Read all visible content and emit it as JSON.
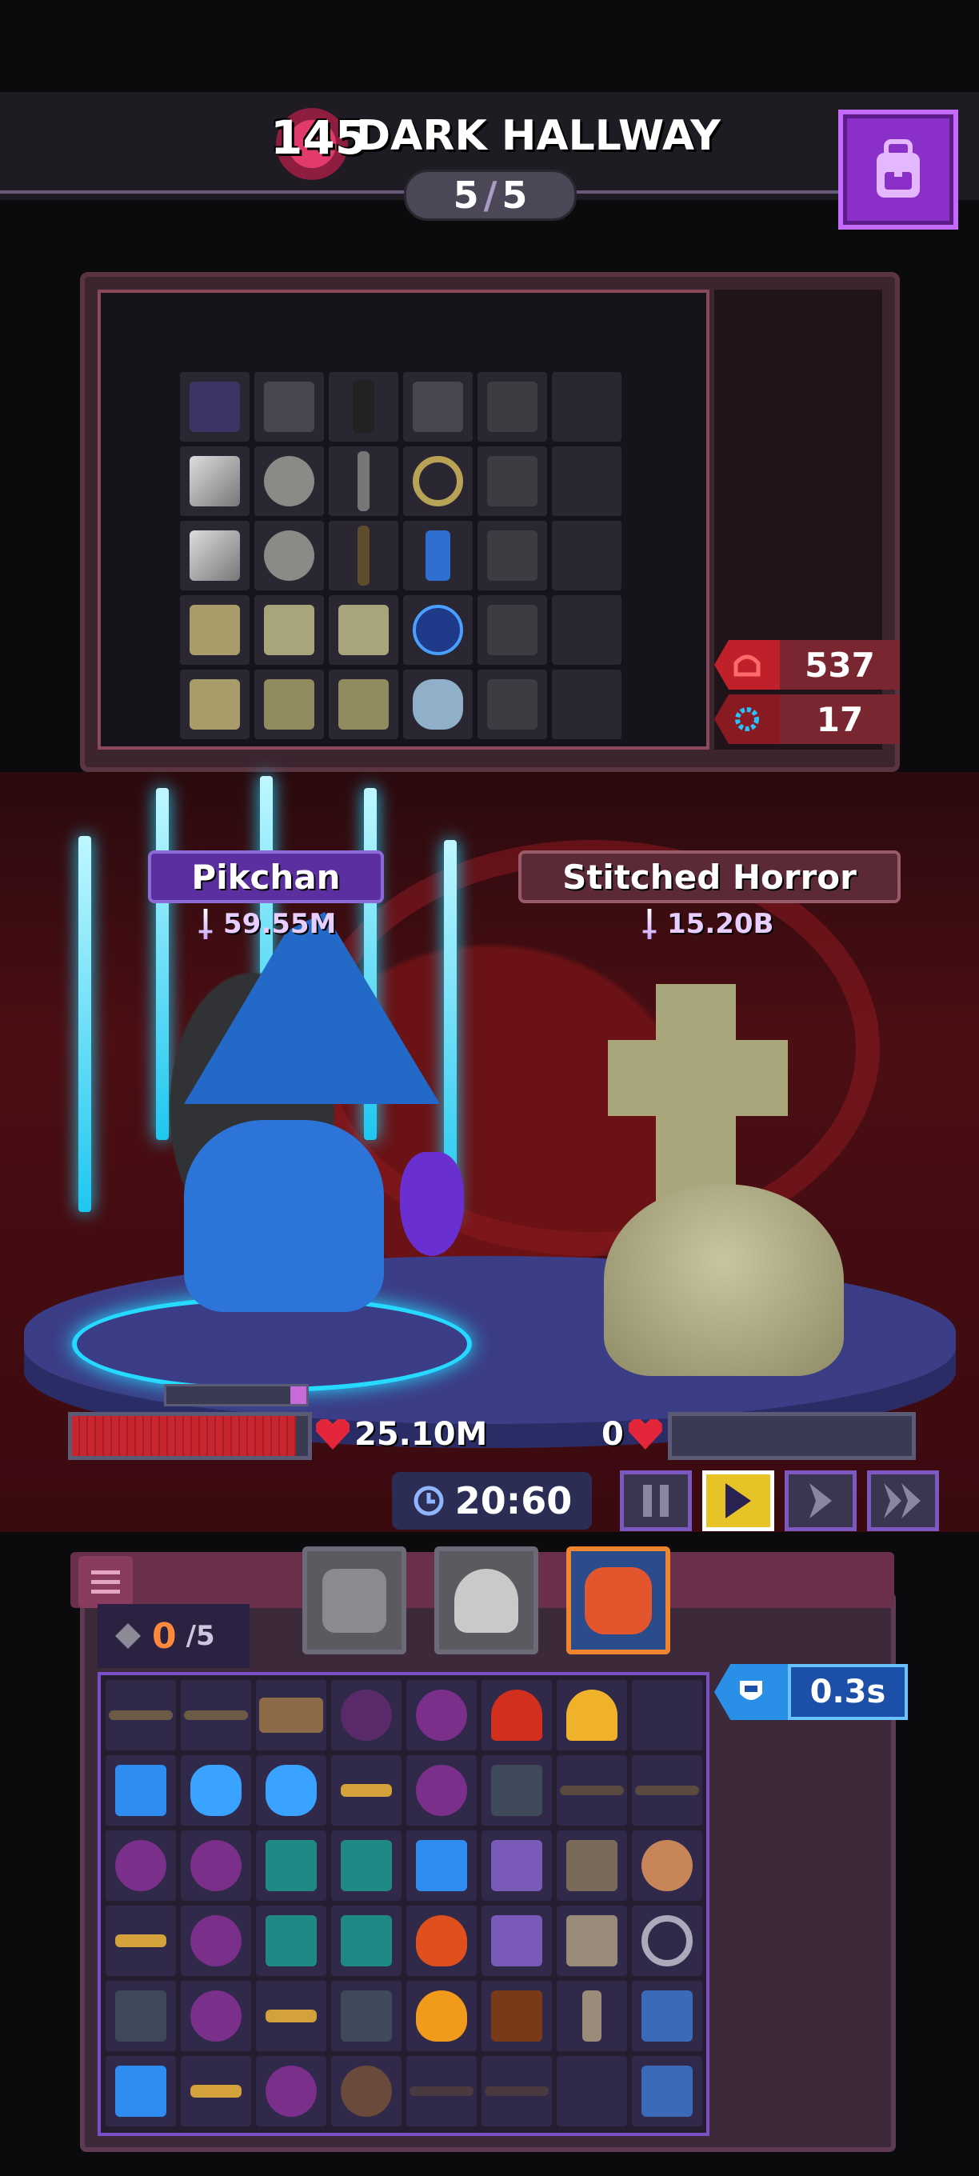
{
  "header": {
    "level": "145",
    "stage_title": "DARK HALLWAY",
    "progress_current": "5",
    "progress_separator": "/",
    "progress_total": "5",
    "backpack_icon": "backpack-icon"
  },
  "enemy_panel": {
    "stats": [
      {
        "icon": "fire-helmet-icon",
        "value": "537",
        "color": "#c0202a"
      },
      {
        "icon": "gear-shield-icon",
        "value": "17",
        "color": "#c0202a"
      }
    ]
  },
  "hero": {
    "name": "Pikchan",
    "power": "59.55M",
    "hp": "25.10M",
    "hp_fraction": 0.95
  },
  "enemy": {
    "name": "Stitched Horror",
    "power": "15.20B",
    "hp": "0",
    "hp_fraction": 0
  },
  "battle": {
    "timer": "20:60",
    "controls": [
      {
        "name": "pause-button",
        "icon": "pause-icon",
        "active": false
      },
      {
        "name": "speed-1x-button",
        "icon": "play-icon",
        "active": true
      },
      {
        "name": "speed-2x-button",
        "icon": "chevron-right-icon",
        "active": false
      },
      {
        "name": "speed-3x-button",
        "icon": "double-chevron-right-icon",
        "active": false
      }
    ]
  },
  "player_panel": {
    "slots_used": "0",
    "slots_total": "/5",
    "cooldown": "0.3s",
    "portraits": [
      {
        "name": "portrait-cat",
        "selected": false
      },
      {
        "name": "portrait-ghost",
        "selected": false
      },
      {
        "name": "portrait-dragon",
        "selected": true
      }
    ]
  },
  "colors": {
    "accent_purple": "#8b2fc9",
    "hp_red": "#c8262f",
    "hero_glow": "#25d9ff"
  }
}
